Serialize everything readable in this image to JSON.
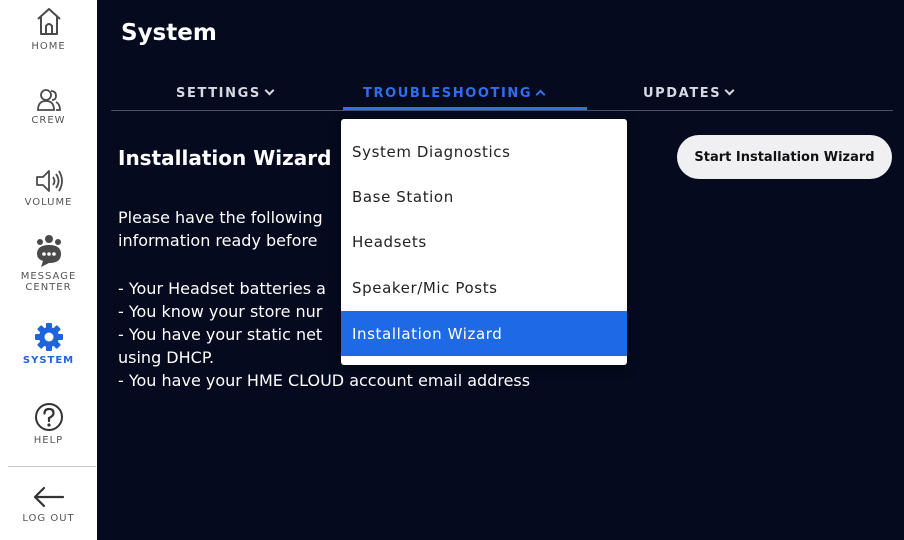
{
  "sidebar": {
    "items": [
      {
        "label": "HOME",
        "icon": "home-icon"
      },
      {
        "label": "CREW",
        "icon": "crew-icon"
      },
      {
        "label": "VOLUME",
        "icon": "volume-icon"
      },
      {
        "label": "MESSAGE CENTER",
        "icon": "message-center-icon"
      },
      {
        "label": "SYSTEM",
        "icon": "gear-icon",
        "active": true
      },
      {
        "label": "HELP",
        "icon": "help-icon"
      },
      {
        "label": "LOG OUT",
        "icon": "logout-arrow-icon"
      }
    ]
  },
  "header": {
    "title": "System"
  },
  "tabs": [
    {
      "label": "SETTINGS",
      "state": "collapsed"
    },
    {
      "label": "TROUBLESHOOTING",
      "state": "expanded",
      "active": true
    },
    {
      "label": "UPDATES",
      "state": "collapsed"
    }
  ],
  "content": {
    "section_title": "Installation Wizard",
    "start_button": "Start Installation Wizard",
    "intro_lines": [
      "Please have the following",
      "information ready before"
    ],
    "checklist_lines": [
      "- Your Headset batteries a",
      "- You know your store nur",
      "- You have your static net",
      "using DHCP.",
      "- You have your HME CLOUD account email address"
    ]
  },
  "dropdown": {
    "items": [
      {
        "label": "System Diagnostics"
      },
      {
        "label": "Base Station"
      },
      {
        "label": "Headsets"
      },
      {
        "label": "Speaker/Mic Posts"
      },
      {
        "label": "Installation Wizard",
        "selected": true
      }
    ]
  },
  "colors": {
    "main_background": "#050a1e",
    "accent": "#2e6ff0",
    "selected_item": "#1e6ae6",
    "sidebar_active": "#1e64dc"
  }
}
